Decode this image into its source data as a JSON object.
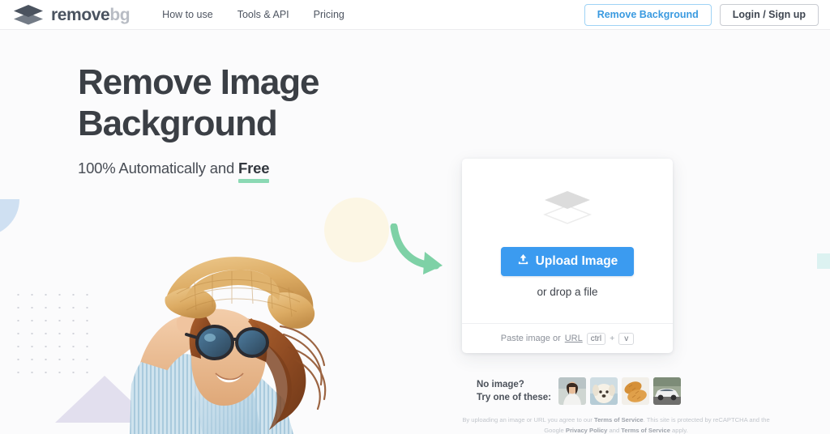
{
  "header": {
    "logo": {
      "icon": "layers-icon",
      "text_primary": "remove",
      "text_secondary": "bg"
    },
    "nav": [
      {
        "label": "How to use"
      },
      {
        "label": "Tools & API"
      },
      {
        "label": "Pricing"
      }
    ],
    "remove_background_button": "Remove Background",
    "login_button": "Login / Sign up"
  },
  "hero": {
    "title_line1": "Remove Image",
    "title_line2": "Background",
    "subtitle_prefix": "100% Automatically and ",
    "subtitle_highlight": "Free"
  },
  "upload": {
    "icon": "layers-icon",
    "button_label": "Upload Image",
    "button_icon": "upload-icon",
    "drop_hint": "or drop a file",
    "paste_prefix": "Paste image or ",
    "paste_link": "URL",
    "key_ctrl": "ctrl",
    "key_plus": "+",
    "key_v": "v"
  },
  "samples": {
    "line1": "No image?",
    "line2": "Try one of these:",
    "thumbnails": [
      {
        "name": "sample-woman"
      },
      {
        "name": "sample-dog"
      },
      {
        "name": "sample-bread"
      },
      {
        "name": "sample-car"
      }
    ]
  },
  "legal": {
    "part1": "By uploading an image or URL you agree to our ",
    "tos1": "Terms of Service",
    "part2": ". This site is protected by reCAPTCHA and the Google ",
    "privacy": "Privacy Policy",
    "part3": " and ",
    "tos2": "Terms of Service",
    "part4": " apply."
  },
  "colors": {
    "accent_blue": "#3b9bf0",
    "link_blue": "#3a9ae0",
    "green_underline": "#8bd9b4",
    "arrow_green": "#7ed1a6",
    "logo_dark": "#4a5360",
    "logo_light": "#b8bcc4",
    "cream_circle": "#fcf6e4",
    "lavender_triangle": "#e2dfee",
    "blue_quarter": "#cfe0f2",
    "cyan_square": "#dcf2f1"
  }
}
